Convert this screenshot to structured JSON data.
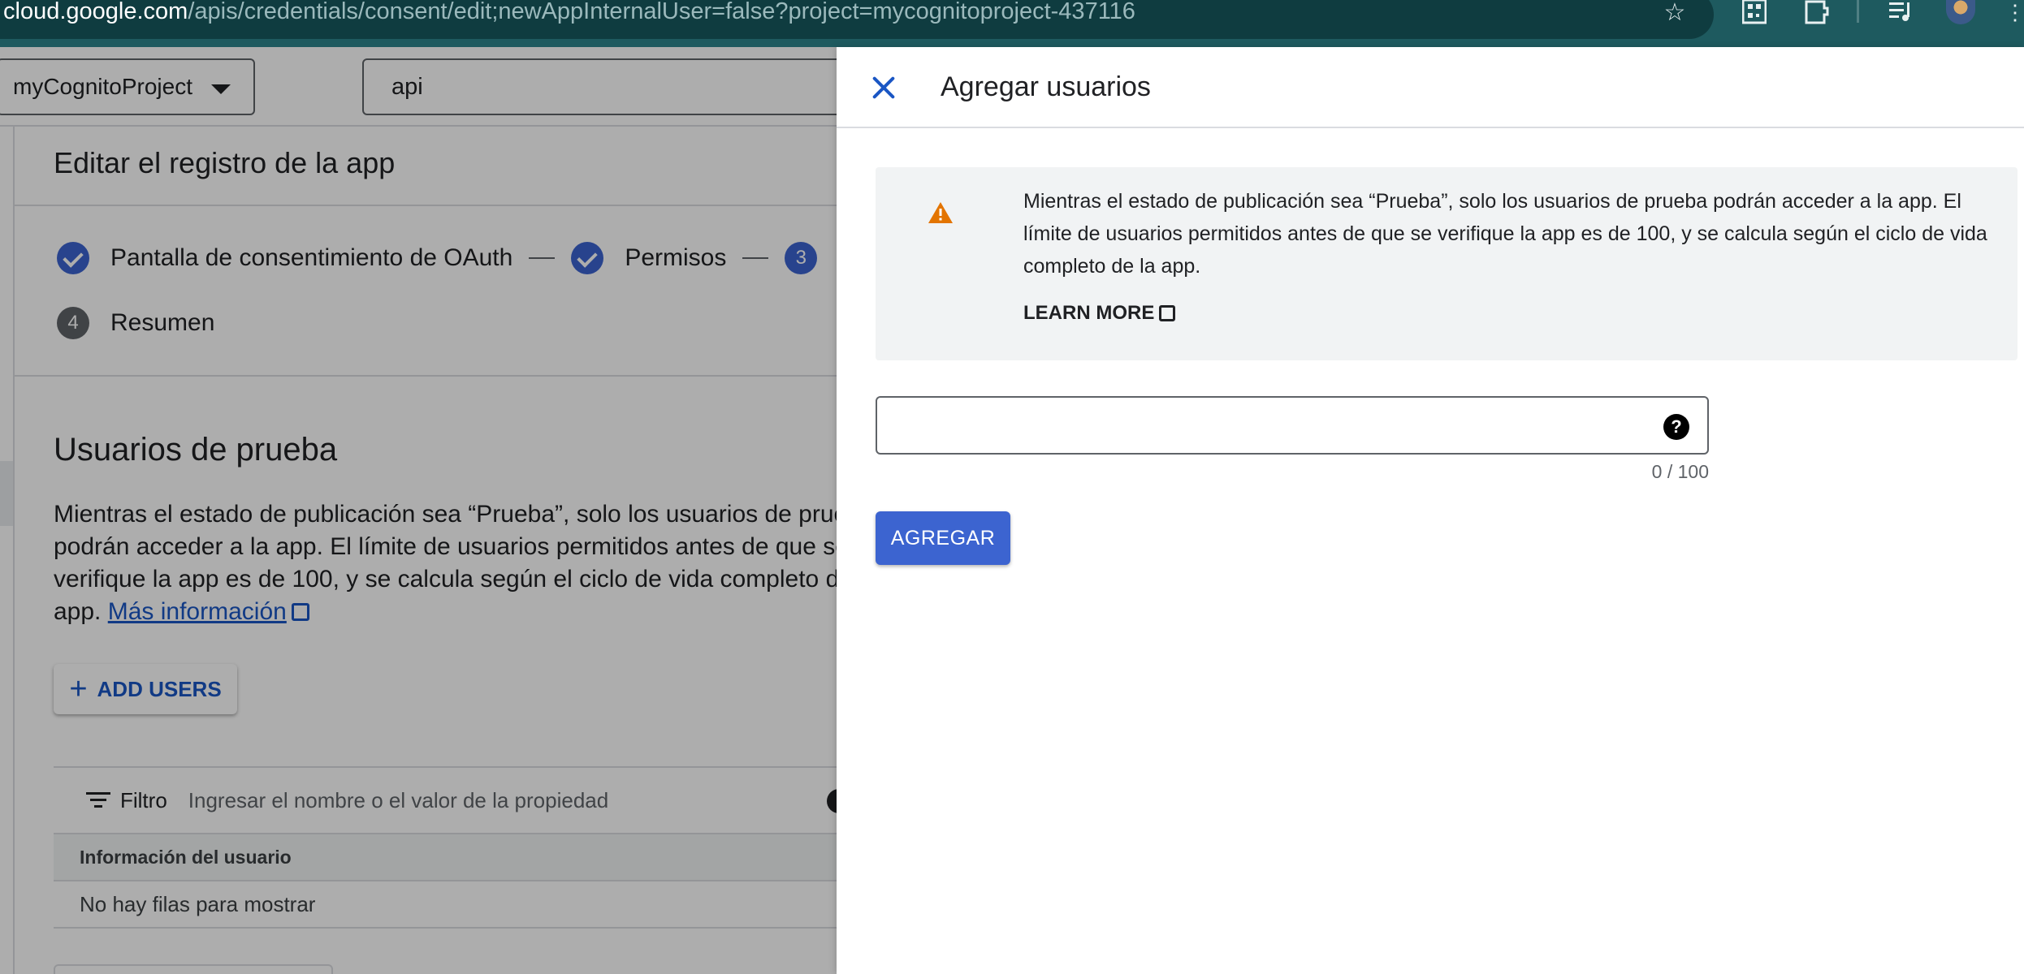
{
  "browser": {
    "url_host": "cloud.google.com",
    "url_path": "/apis/credentials/consent/edit;newAppInternalUser=false?project=mycognitoproject-437116"
  },
  "header": {
    "project_name": "myCognitoProject",
    "search_value": "api"
  },
  "page": {
    "title": "Editar el registro de la app",
    "steps": [
      {
        "label": "Pantalla de consentimiento de OAuth",
        "state": "done"
      },
      {
        "label": "Permisos",
        "state": "done"
      },
      {
        "number": "3",
        "label": "",
        "state": "active"
      },
      {
        "number": "4",
        "label": "Resumen",
        "state": "pending"
      }
    ],
    "section_title": "Usuarios de prueba",
    "section_text_lines": [
      "Mientras el estado de publicación sea “Prueba”, solo los usuarios de prue",
      "podrán acceder a la app. El límite de usuarios permitidos antes de que se",
      "verifique la app es de 100, y se calcula según el ciclo de vida completo de",
      "app. "
    ],
    "more_info_link": "Más información",
    "add_users_label": "ADD USERS",
    "filter_label": "Filtro",
    "filter_placeholder": "Ingresar el nombre o el valor de la propiedad",
    "table_header": "Información del usuario",
    "table_empty": "No hay filas para mostrar"
  },
  "panel": {
    "title": "Agregar usuarios",
    "notice_lines": [
      "Mientras el estado de publicación sea “Prueba”, solo los usuarios de prueba podrán acceder a la app. El",
      "límite de usuarios permitidos antes de que se verifique la app es de 100, y se calcula según el ciclo de vida",
      "completo de la app."
    ],
    "learn_more": "LEARN MORE",
    "input_value": "",
    "counter": "0 / 100",
    "submit_label": "AGREGAR"
  },
  "colors": {
    "accent_blue": "#3c64d0",
    "link_blue": "#1a56c4",
    "warning_orange": "#e37400",
    "browser_teal": "#1e5a5f"
  },
  "icons": {
    "close": "close-icon",
    "warning": "warning-icon",
    "help": "help-icon",
    "external_link": "external-link-icon",
    "filter": "filter-icon",
    "star": "star-icon"
  }
}
